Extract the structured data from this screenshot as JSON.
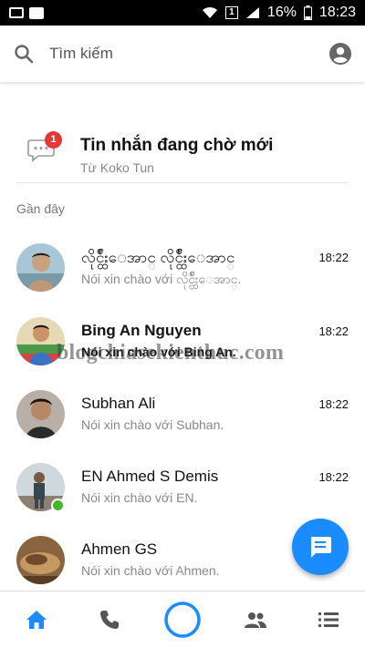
{
  "status_bar": {
    "battery_percent": "16%",
    "time": "18:23"
  },
  "search": {
    "placeholder": "Tìm kiếm"
  },
  "pending": {
    "badge_count": "1",
    "title": "Tin nhắn đang chờ mới",
    "subtitle": "Từ Koko Tun"
  },
  "recent": {
    "section_label": "Gần đây",
    "conversations": [
      {
        "name": "လိုင္ငွ်ဳးေအာင္ လိုင္ငွ်ဳးေအာင္",
        "preview": "Nói xin chào với လိုင္ငွ်ဳးေအာင္.",
        "time": "18:22",
        "unread": false,
        "online": false
      },
      {
        "name": "Bing An Nguyen",
        "preview": "Nói xin chào với Bing An.",
        "time": "18:22",
        "unread": true,
        "online": false
      },
      {
        "name": "Subhan Ali",
        "preview": "Nói xin chào với Subhan.",
        "time": "18:22",
        "unread": false,
        "online": false
      },
      {
        "name": "EN Ahmed S Demis",
        "preview": "Nói xin chào với EN.",
        "time": "18:22",
        "unread": false,
        "online": true
      },
      {
        "name": "Ahmen GS",
        "preview": "Nói xin chào với Ahmen.",
        "time": "",
        "unread": false,
        "online": false
      }
    ]
  },
  "watermark": "blogchiasekienthuc.com",
  "colors": {
    "accent": "#1a8cff",
    "badge": "#e53935",
    "online": "#42b72a"
  },
  "bottom_nav": {
    "items": [
      "home-icon",
      "phone-icon",
      "camera-circle-icon",
      "people-icon",
      "list-icon"
    ]
  }
}
